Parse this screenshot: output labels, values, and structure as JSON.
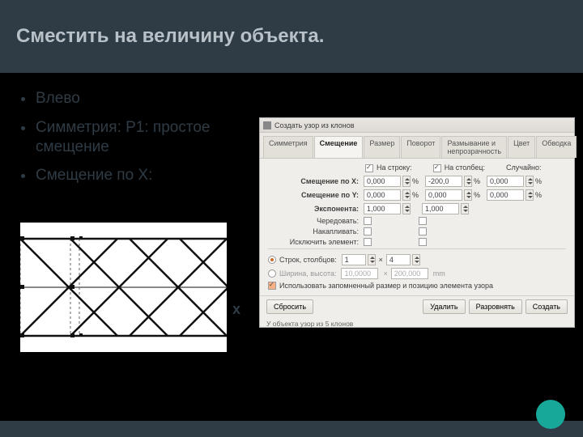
{
  "header": {
    "title": "Сместить на величину объекта."
  },
  "bullets": [
    "Влево",
    "Симметрия: P1: простое смещение",
    "Смещение по X:"
  ],
  "stray_x": "x",
  "dialog": {
    "title": "Создать узор из клонов",
    "tabs": [
      "Симметрия",
      "Смещение",
      "Размер",
      "Поворот",
      "Размывание и непрозрачность",
      "Цвет",
      "Обводка"
    ],
    "active_tab": 1,
    "cols": {
      "row": "На строку:",
      "col": "На столбец:",
      "rand": "Случайно:",
      "row_checked": true,
      "col_checked": true
    },
    "offset_x": {
      "label": "Смещение по X:",
      "row": "0,000",
      "col": "-200,0",
      "rand": "0,000"
    },
    "offset_y": {
      "label": "Смещение по Y:",
      "row": "0,000",
      "col": "0,000",
      "rand": "0,000"
    },
    "exponent": {
      "label": "Экспонента:",
      "row": "1,000",
      "col": "1,000"
    },
    "alternate": {
      "label": "Чередовать:"
    },
    "accumulate": {
      "label": "Накапливать:"
    },
    "exclude": {
      "label": "Исключить элемент:"
    },
    "rows_cols": {
      "label": "Строк, столбцов:",
      "rows": "1",
      "cols": "4"
    },
    "width_height": {
      "label": "Ширина, высота:",
      "w": "10,0000",
      "h": "200,000",
      "unit": "mm"
    },
    "use_saved": {
      "label": "Использовать запомненный размер и позицию элемента узора",
      "checked": true
    },
    "buttons": {
      "reset": "Сбросить",
      "delete": "Удалить",
      "unclump": "Разровнять",
      "create": "Создать"
    },
    "status": "У объекта узор из 5 клонов"
  }
}
